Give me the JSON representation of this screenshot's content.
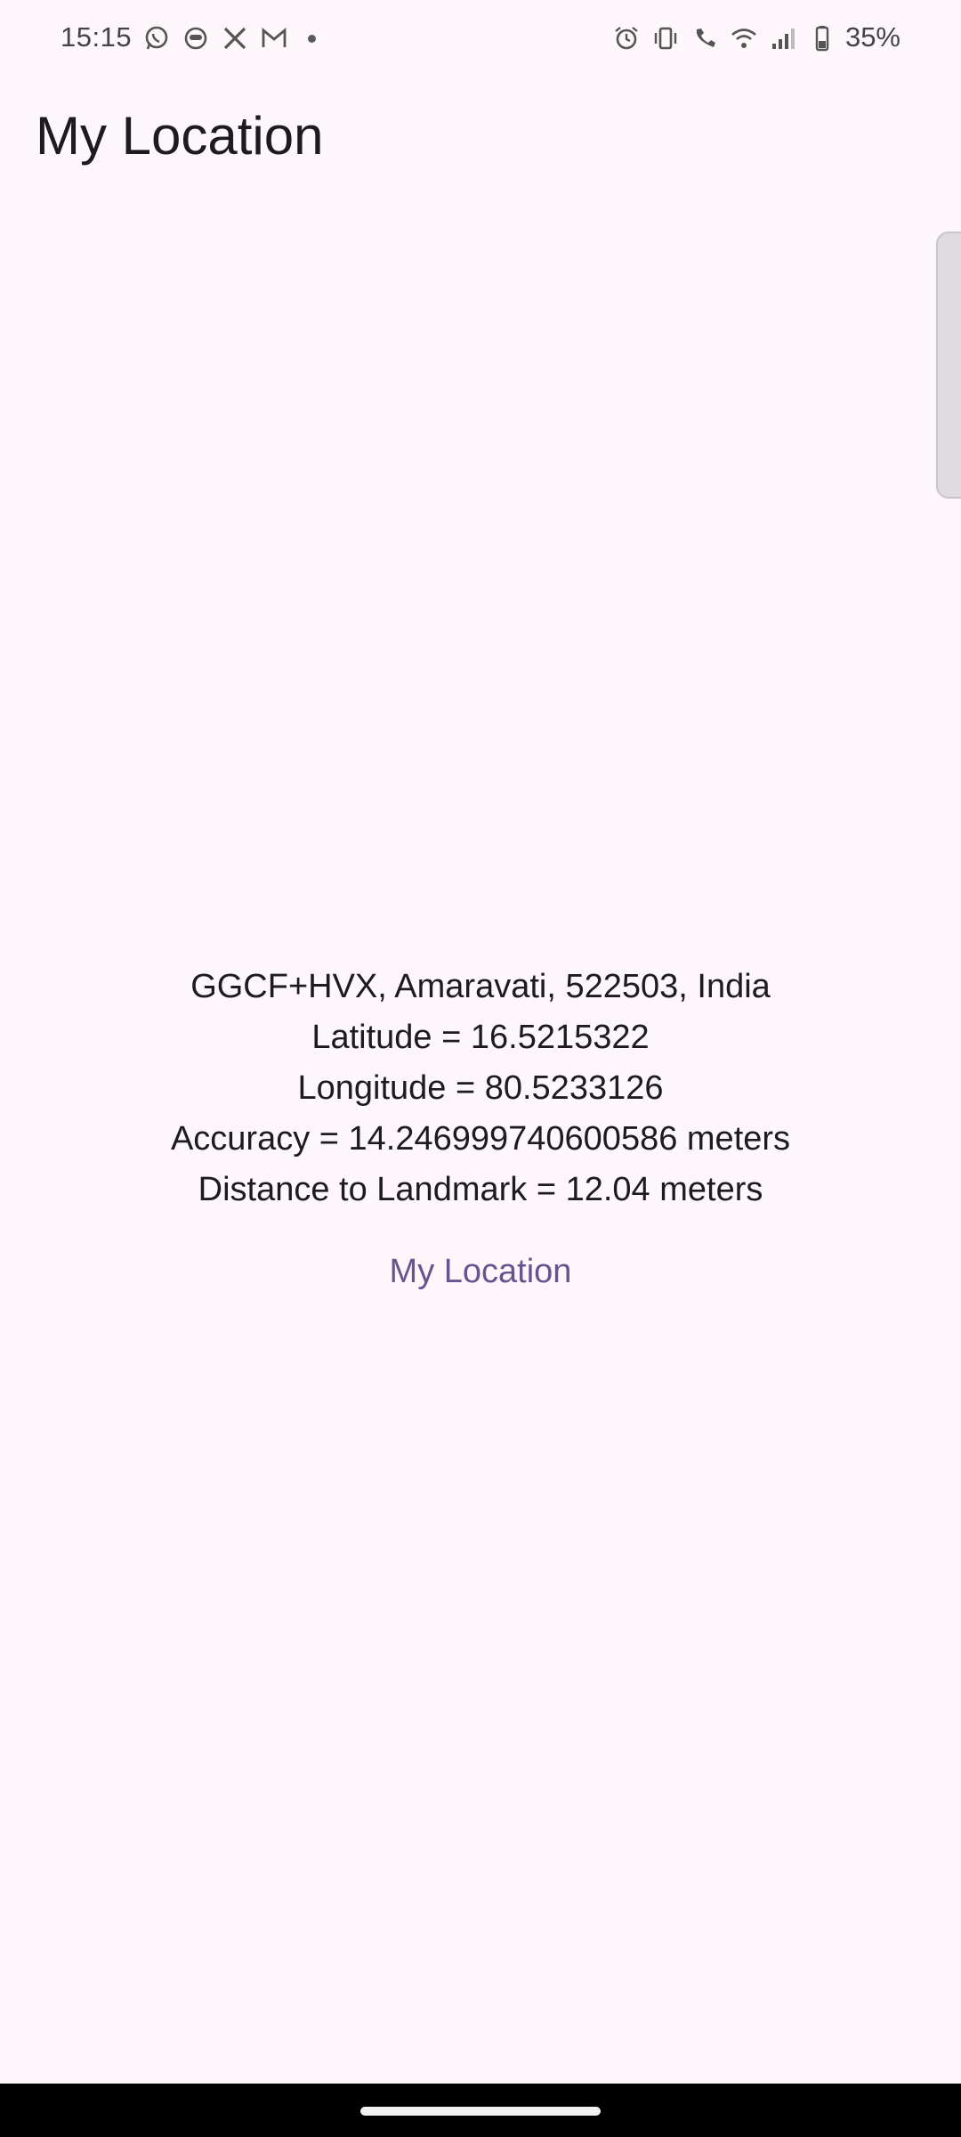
{
  "status_bar": {
    "time": "15:15",
    "battery_percent": "35%",
    "left_icons": [
      "whatsapp-icon",
      "chat-bubble-icon",
      "x-icon",
      "gmail-icon",
      "notification-dot-icon"
    ],
    "right_icons": [
      "alarm-icon",
      "vibrate-icon",
      "wifi-calling-icon",
      "wifi-icon",
      "signal-icon",
      "battery-icon"
    ]
  },
  "app_bar": {
    "title": "My Location"
  },
  "location": {
    "address": "GGCF+HVX, Amaravati, 522503, India",
    "latitude_text": "Latitude = 16.5215322",
    "longitude_text": "Longitude = 80.5233126",
    "accuracy_text": "Accuracy = 14.246999740600586 meters",
    "distance_text": "Distance to Landmark = 12.04 meters"
  },
  "actions": {
    "my_location_label": "My Location"
  },
  "colors": {
    "background": "#fdf7fb",
    "primary": "#65558f",
    "text": "#1d1b20"
  }
}
